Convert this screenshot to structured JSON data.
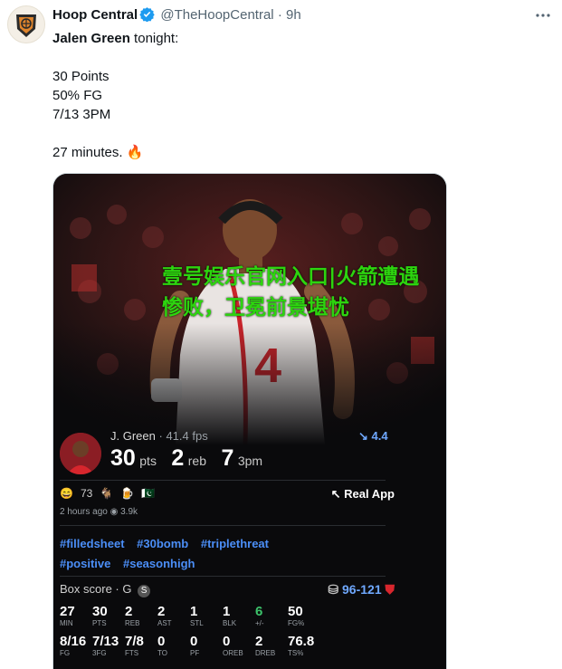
{
  "tweet": {
    "author_name": "Hoop Central",
    "handle": "@TheHoopCentral",
    "separator": "·",
    "time": "9h",
    "more_icon": "more-horizontal-icon",
    "verified_icon": "verified-badge-icon",
    "line1_name": "Jalen Green",
    "line1_rest": " tonight:",
    "stat1": "30 Points",
    "stat2": "50% FG",
    "stat3": "7/13 3PM",
    "closing": "27 minutes. 🔥"
  },
  "media": {
    "overlay_text": "壹号娱乐官网入口|火箭遭遇惨败，卫冕前景堪忧",
    "card": {
      "player": "J. Green",
      "separator": "·",
      "fps": "41.4 fps",
      "rank": "4.4",
      "pts": "30",
      "pts_label": "pts",
      "reb": "2",
      "reb_label": "reb",
      "threes": "7",
      "threes_label": "3pm"
    },
    "reactions": {
      "emoji_count": "73",
      "real_app": "Real App",
      "posted": "2 hours ago",
      "views": "3.9k"
    },
    "hashtags": [
      "#filledsheet",
      "#30bomb",
      "#triplethreat",
      "#positive",
      "#seasonhigh"
    ],
    "box_score": {
      "title": "Box score · G",
      "badge": "S",
      "score": "96-121",
      "row1": [
        {
          "value": "27",
          "label": "MIN"
        },
        {
          "value": "30",
          "label": "PTS"
        },
        {
          "value": "2",
          "label": "REB"
        },
        {
          "value": "2",
          "label": "AST"
        },
        {
          "value": "1",
          "label": "STL"
        },
        {
          "value": "1",
          "label": "BLK"
        },
        {
          "value": "6",
          "label": "+/-"
        },
        {
          "value": "50",
          "label": "FG%"
        }
      ],
      "row2": [
        {
          "value": "8/16",
          "label": "FG"
        },
        {
          "value": "7/13",
          "label": "3FG"
        },
        {
          "value": "7/8",
          "label": "FTS"
        },
        {
          "value": "0",
          "label": "TO"
        },
        {
          "value": "0",
          "label": "PF"
        },
        {
          "value": "0",
          "label": "OREB"
        },
        {
          "value": "2",
          "label": "DREB"
        },
        {
          "value": "76.8",
          "label": "TS%"
        }
      ]
    }
  },
  "colors": {
    "overlay_green": "#2dd40f",
    "link_blue": "#4b8ef7",
    "verified_blue": "#1d9bf0",
    "media_bg": "#0a0a0c"
  }
}
